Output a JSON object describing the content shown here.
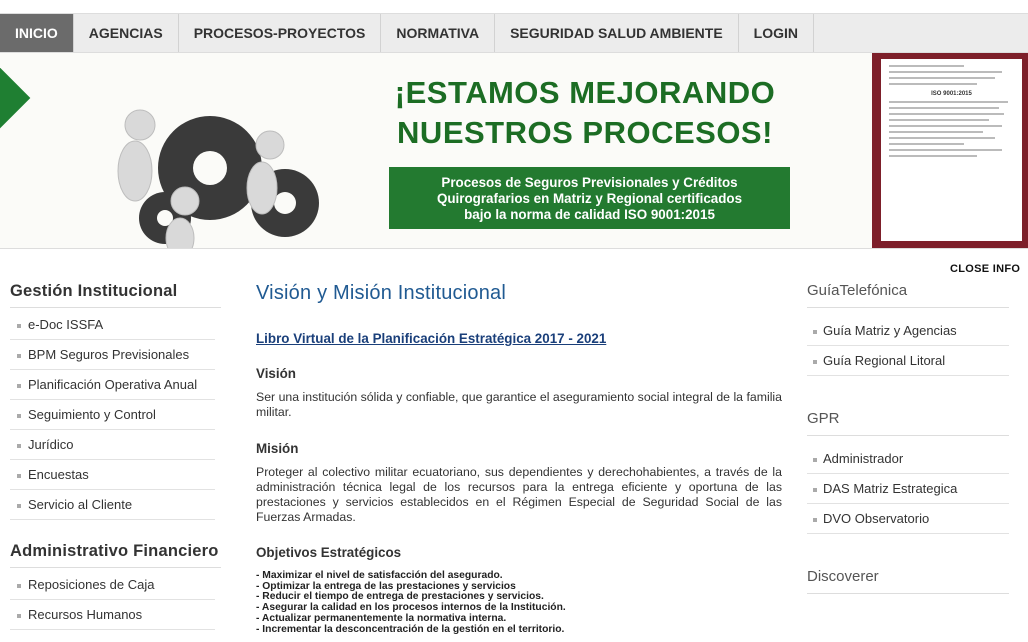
{
  "nav": [
    "INICIO",
    "AGENCIAS",
    "PROCESOS-PROYECTOS",
    "NORMATIVA",
    "SEGURIDAD SALUD AMBIENTE",
    "LOGIN"
  ],
  "banner": {
    "title_line1": "¡ESTAMOS MEJORANDO",
    "title_line2": "NUESTROS PROCESOS!",
    "sub_line1": "Procesos de Seguros Previsionales y Créditos",
    "sub_line2": "Quirografarios en Matriz y Regional certificados",
    "sub_line3": "bajo la norma de calidad ISO 9001:2015",
    "cert_iso": "ISO 9001:2015"
  },
  "close_info": "CLOSE INFO",
  "left": {
    "gestion_title": "Gestión Institucional",
    "gestion_items": [
      "e-Doc ISSFA",
      "BPM Seguros Previsionales",
      "Planificación Operativa Anual",
      "Seguimiento y Control",
      "Jurídico",
      "Encuestas",
      "Servicio al Cliente"
    ],
    "admin_title": "Administrativo Financiero",
    "admin_items": [
      "Reposiciones de Caja",
      "Recursos Humanos"
    ]
  },
  "main": {
    "title": "Visión y Misión Institucional",
    "link": "Libro Virtual de la Planificación Estratégica 2017 - 2021",
    "vision_h": "Visión",
    "vision_p": "Ser una institución sólida  y confiable, que garantice el aseguramiento social integral de la familia militar.",
    "mision_h": "Misión",
    "mision_p": "Proteger al colectivo militar ecuatoriano, sus dependientes y derechohabientes, a través de la administración técnica legal de los recursos para la entrega eficiente y oportuna de las prestaciones y servicios establecidos en el Régimen Especial de Seguridad Social de las Fuerzas Armadas.",
    "obj_h": "Objetivos Estratégicos",
    "objectives": [
      "- Maximizar el nivel de satisfacción del asegurado.",
      "- Optimizar la entrega de las prestaciones y servicios",
      "- Reducir el tiempo de entrega de prestaciones y servicios.",
      "- Asegurar la calidad en los procesos internos de la Institución.",
      "- Actualizar permanentemente la normativa interna.",
      "- Incrementar la desconcentración de la gestión en el territorio."
    ]
  },
  "right": {
    "guia_title": "GuíaTelefónica",
    "guia_items": [
      "Guía Matriz y Agencias",
      "Guía Regional Litoral"
    ],
    "gpr_title": "GPR",
    "gpr_items": [
      "Administrador",
      "DAS Matriz Estrategica",
      "DVO Observatorio"
    ],
    "disc_title": "Discoverer"
  },
  "colors": {
    "nav_active": "#6b6b6b",
    "banner_green": "#237a30",
    "title_blue": "#205a92"
  }
}
